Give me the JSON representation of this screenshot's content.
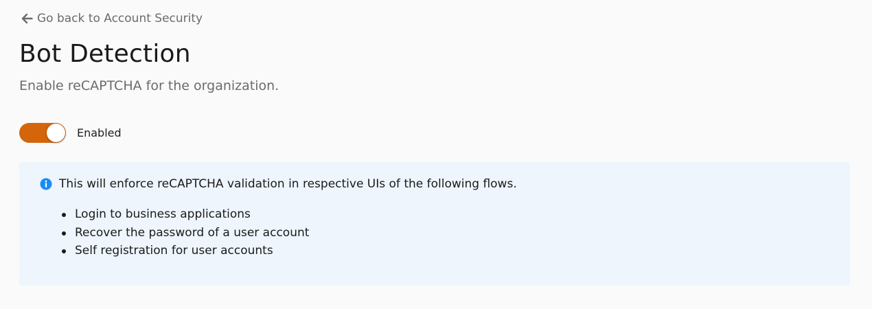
{
  "back_link": {
    "icon": "arrow-left-icon",
    "label": "Go back to Account Security"
  },
  "header": {
    "title": "Bot Detection",
    "subtitle": "Enable reCAPTCHA for the organization."
  },
  "toggle": {
    "state": "on",
    "label": "Enabled",
    "accent_color": "#d4650a"
  },
  "info_box": {
    "icon": "info-icon",
    "icon_color": "#1a8cf0",
    "background_color": "#eef5fd",
    "message": "This will enforce reCAPTCHA validation in respective UIs of the following flows.",
    "items": [
      "Login to business applications",
      "Recover the password of a user account",
      "Self registration for user accounts"
    ]
  }
}
